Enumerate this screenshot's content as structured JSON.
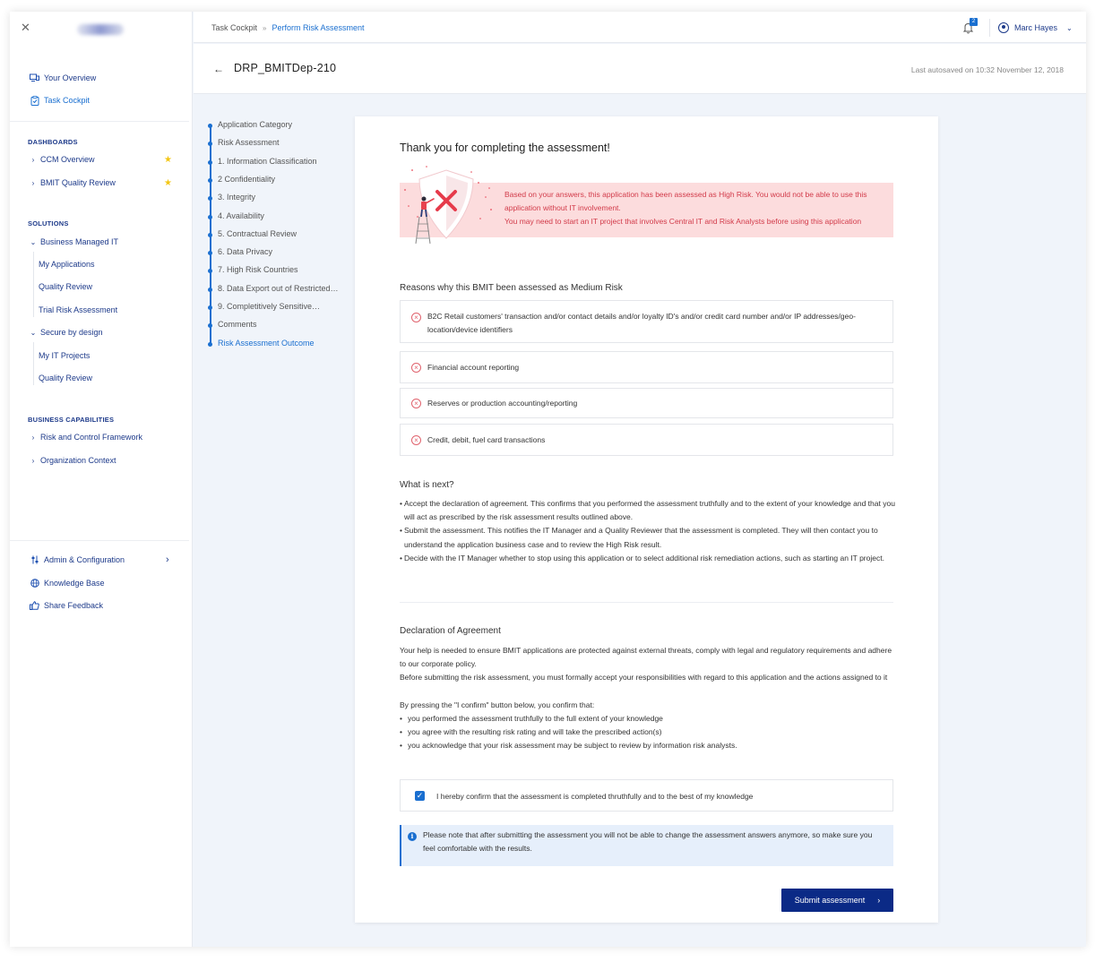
{
  "sidebar": {
    "close_icon": "close-icon",
    "nav": [
      {
        "label": "Your Overview",
        "icon": "overview-icon"
      },
      {
        "label": "Task Cockpit",
        "icon": "clipboard-icon",
        "active": true
      }
    ],
    "dashboards": {
      "heading": "DASHBOARDS",
      "items": [
        {
          "label": "CCM Overview",
          "starred": true
        },
        {
          "label": "BMIT Quality Review",
          "starred": true
        }
      ]
    },
    "solutions": {
      "heading": "SOLUTIONS",
      "groups": [
        {
          "label": "Business Managed IT",
          "children": [
            "My Applications",
            "Quality Review",
            "Trial Risk Assessment"
          ]
        },
        {
          "label": "Secure by design",
          "children": [
            "My IT Projects",
            "Quality Review"
          ]
        }
      ]
    },
    "business_capabilities": {
      "heading": "BUSINESS CAPABILITIES",
      "items": [
        {
          "label": "Risk and Control Framework"
        },
        {
          "label": "Organization Context"
        }
      ]
    },
    "footer": [
      {
        "label": "Admin & Configuration",
        "icon": "sliders-icon"
      },
      {
        "label": "Knowledge Base",
        "icon": "globe-icon"
      },
      {
        "label": "Share Feedback",
        "icon": "thumbs-up-icon"
      }
    ]
  },
  "topbar": {
    "breadcrumb": [
      "Task Cockpit",
      "Perform Risk Assessment"
    ],
    "breadcrumb_sep": "»",
    "notifications_count": "2",
    "user_name": "Marc Hayes"
  },
  "page": {
    "title": "DRP_BMITDep-210",
    "autosave": "Last autosaved on 10:32 November 12, 2018"
  },
  "steps": [
    "Application Category",
    "Risk Assessment",
    "1. Information Classification",
    "2 Confidentiality",
    "3. Integrity",
    "4. Availability",
    "5. Contractual Review",
    "6. Data Privacy",
    "7. High Risk Countries",
    "8. Data Export out of Restricted…",
    "9. Completitively Sensitive…",
    "Comments",
    "Risk Assessment Outcome"
  ],
  "current_step": "Risk Assessment Outcome",
  "card": {
    "title": "Thank you for completing the assessment!",
    "alert_lines": [
      "Based on your answers, this application has been assessed as High Risk. You would not be able to use this application without IT involvement.",
      "You may need to start an IT project that involves Central IT and Risk Analysts before using this application"
    ],
    "reasons_title": "Reasons why this BMIT been assessed as Medium Risk",
    "reasons": [
      "B2C Retail customers' transaction and/or contact details and/or loyalty ID's and/or credit card number and/or IP addresses/geo-location/device identifiers",
      "Financial account reporting",
      "Reserves or production accounting/reporting",
      "Credit, debit, fuel card transactions"
    ],
    "next_title": "What is next?",
    "next_items": [
      "Accept the declaration of agreement. This confirms that you performed the assessment truthfully and to the extent of your knowledge and that you will act as prescribed by the risk assessment results outlined above.",
      "Submit the assessment. This notifies the IT Manager and a Quality Reviewer that the assessment is completed. They will then contact you to understand the application business case and to review the High Risk result.",
      "Decide with the IT Manager whether to stop using this application or to select additional risk remediation actions, such as starting an IT project."
    ],
    "declaration_title": "Declaration of Agreement",
    "declaration_p1": "Your help is needed to ensure BMIT applications are protected against external threats, comply with legal and regulatory requirements and adhere to our corporate policy.",
    "declaration_p2": "Before submitting the risk assessment, you must formally accept your responsibilities with regard to this application and the actions assigned to it",
    "declaration_lead": "By pressing the \"I confirm\" button below, you confirm that:",
    "declaration_items": [
      "you performed the assessment truthfully to the full extent of your knowledge",
      "you agree with the resulting risk rating and will take the prescribed action(s)",
      "you acknowledge that your risk assessment may be subject to review by information risk analysts."
    ],
    "confirm_label": "I hereby confirm that the assessment is completed thruthfully and to the best of my knowledge",
    "confirm_checked": true,
    "note": "Please note that after submitting the assessment you will not be able to change the assessment answers anymore, so make sure you feel comfortable with the results.",
    "submit_label": "Submit assessment"
  },
  "colors": {
    "accent": "#1a6fd0",
    "navy": "#1d3a8a",
    "submit_bg": "#0b2a86",
    "alert_bg": "#fcdcdd",
    "alert_text": "#d23b4a",
    "star": "#f3c614"
  }
}
